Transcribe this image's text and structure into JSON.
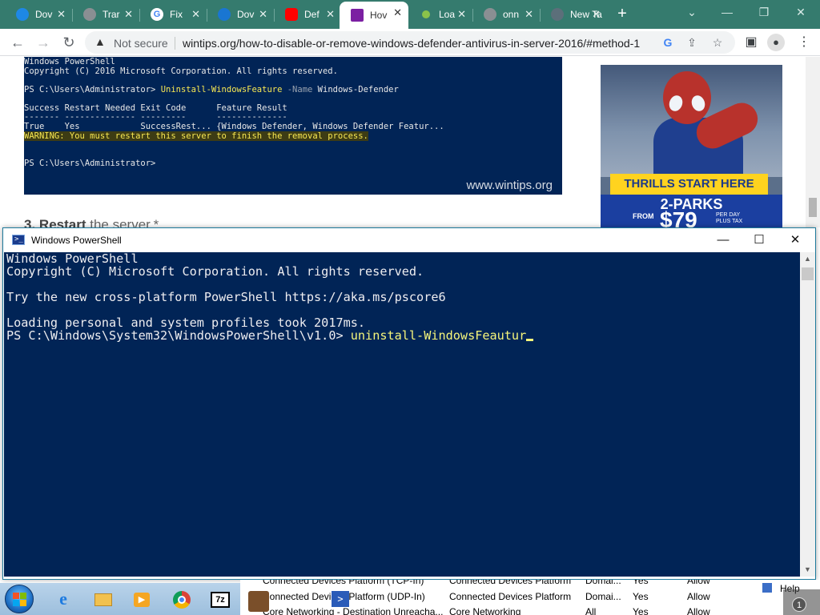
{
  "browser": {
    "tabs": [
      {
        "title": "Dov",
        "icon": "windows-icon",
        "color": "#1e88e5"
      },
      {
        "title": "Trar",
        "icon": "globe-icon",
        "color": "#9e9e9e"
      },
      {
        "title": "Fix",
        "icon": "google-icon",
        "color": "#ffffff"
      },
      {
        "title": "Dov",
        "icon": "download-icon",
        "color": "#1976d2"
      },
      {
        "title": "Def",
        "icon": "youtube-icon",
        "color": "#ff0000"
      },
      {
        "title": "Hov",
        "icon": "wintips-icon",
        "color": "#7b1fa2"
      },
      {
        "title": "Loa",
        "icon": "dot-icon",
        "color": "#8bc34a"
      },
      {
        "title": "onn",
        "icon": "globe-icon",
        "color": "#9e9e9e"
      },
      {
        "title": "New Tal",
        "icon": "chrome-icon",
        "color": "#607d8b"
      }
    ],
    "new_tab_symbol": "+",
    "window_controls": {
      "dropdown": "⌄",
      "minimize": "—",
      "restore": "❐",
      "close": "✕"
    },
    "address": {
      "security_label": "Not secure",
      "url": "wintips.org/how-to-disable-or-remove-windows-defender-antivirus-in-server-2016/#method-1"
    }
  },
  "article": {
    "screenshot_lines": {
      "title": "Windows PowerShell",
      "copyright": "Copyright (C) 2016 Microsoft Corporation. All rights reserved.",
      "prompt1": "PS C:\\Users\\Administrator> ",
      "cmd": "Uninstall-WindowsFeature",
      "param": " -Name ",
      "arg": "Windows-Defender",
      "header": "Success Restart Needed Exit Code      Feature Result",
      "dashes": "------- -------------- ---------      --------------",
      "result": "True    Yes            SuccessRest... {Windows Defender, Windows Defender Featur...",
      "warning": "WARNING: You must restart this server to finish the removal process.",
      "prompt2": "PS C:\\Users\\Administrator>",
      "watermark": "www.wintips.org"
    },
    "step_number": "3.",
    "step_bold": "Restart",
    "step_rest": " the server.*"
  },
  "ad": {
    "banner": "THRILLS START HERE",
    "parks": "2-PARKS",
    "from": "FROM",
    "price": "$79",
    "per_day_1": "PER DAY",
    "per_day_2": "PLUS TAX"
  },
  "powershell": {
    "title": "Windows PowerShell",
    "lines": [
      "Windows PowerShell",
      "Copyright (C) Microsoft Corporation. All rights reserved.",
      "",
      "Try the new cross-platform PowerShell https://aka.ms/pscore6",
      "",
      "Loading personal and system profiles took 2017ms."
    ],
    "prompt": "PS C:\\Windows\\System32\\WindowsPowerShell\\v1.0> ",
    "typed": "uninstall-WindowsFeautur"
  },
  "background_list": {
    "rows": [
      {
        "name": "Connected Devices Platform (TCP-In)",
        "group": "Connected Devices Platform",
        "profile": "Domai...",
        "enabled": "Yes",
        "action": "Allow"
      },
      {
        "name": "Connected Devices Platform (UDP-In)",
        "group": "Connected Devices Platform",
        "profile": "Domai...",
        "enabled": "Yes",
        "action": "Allow"
      },
      {
        "name": "Core Networking - Destination Unreacha...",
        "group": "Core Networking",
        "profile": "All",
        "enabled": "Yes",
        "action": "Allow"
      }
    ],
    "help": "Help"
  },
  "taskbar": {
    "apps": [
      "internet-explorer-icon",
      "folder-icon",
      "media-player-icon",
      "chrome-icon",
      "7zip-icon"
    ],
    "app_7zip_label": "7z",
    "notification_count": "1"
  }
}
